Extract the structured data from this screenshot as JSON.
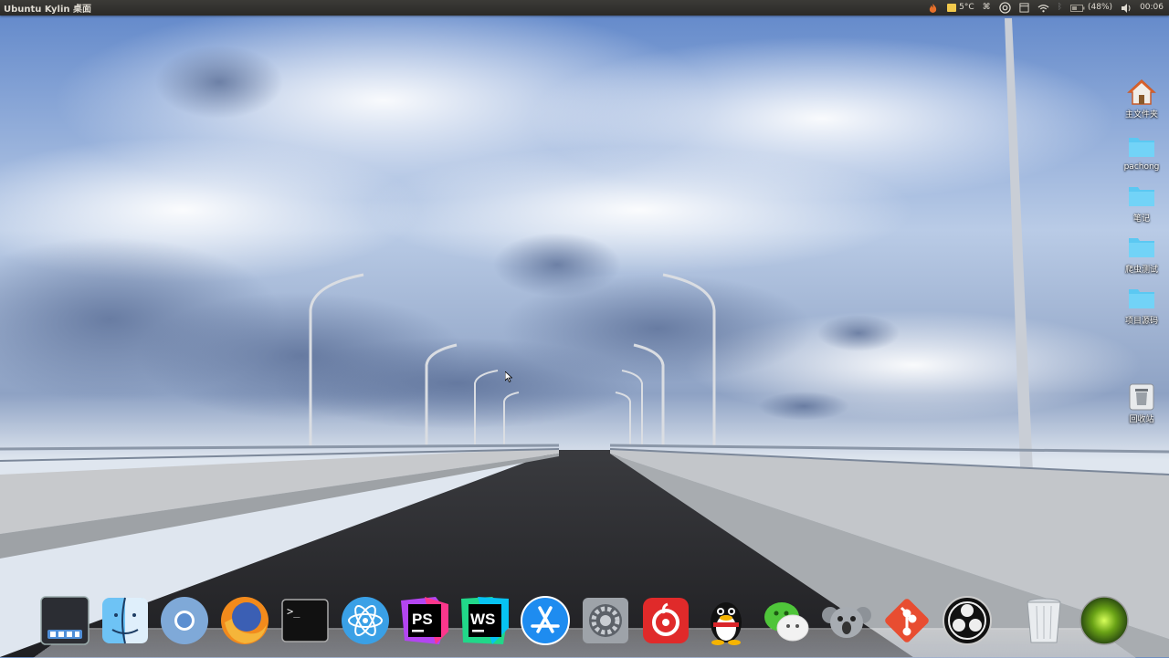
{
  "panel": {
    "title": "Ubuntu Kylin 桌面",
    "weather_temp": "5°C",
    "battery": "(48%)",
    "clock": "00:06",
    "icons": [
      "fire-icon",
      "weather-icon",
      "keyboard-icon",
      "ubuntu-logo-icon",
      "calendar-icon",
      "wifi-icon",
      "bluetooth-icon",
      "battery-icon",
      "volume-icon"
    ]
  },
  "desktop": {
    "icons": [
      {
        "label": "主文件夹",
        "icon": "home-icon"
      },
      {
        "label": "pachong",
        "icon": "folder-icon"
      },
      {
        "label": "笔记",
        "icon": "folder-icon"
      },
      {
        "label": "爬虫测试",
        "icon": "folder-icon"
      },
      {
        "label": "项目源码",
        "icon": "folder-icon"
      },
      {
        "label": "回收站",
        "icon": "trash-icon"
      }
    ]
  },
  "dock": {
    "items": [
      "workspace-switcher",
      "finder",
      "chromium",
      "firefox",
      "terminal",
      "atom",
      "phpstorm",
      "webstorm",
      "app-store",
      "system-settings",
      "netease-music",
      "qq",
      "wechat",
      "koala",
      "git",
      "obs-studio",
      "trash",
      "green-orb"
    ],
    "ps_label": "PS",
    "ws_label": "WS",
    "terminal_prompt": ">_"
  },
  "colors": {
    "panel_bg": "#3c3b37",
    "sky": "#6f8fc2",
    "folder": "#5bc8f2"
  }
}
